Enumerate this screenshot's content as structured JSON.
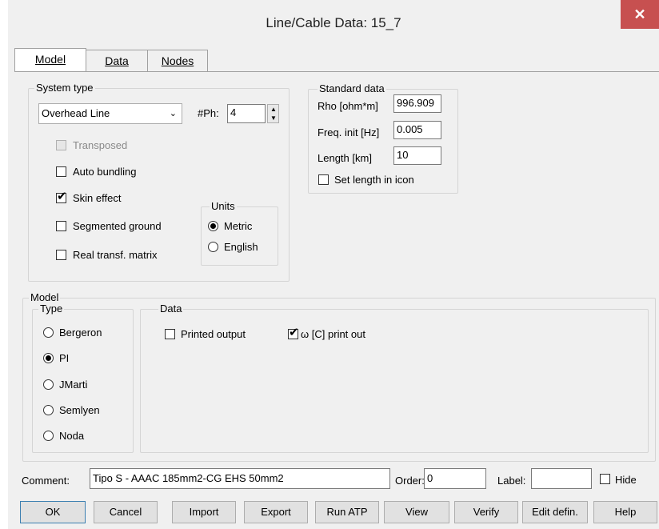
{
  "window": {
    "title": "Line/Cable Data: 15_7",
    "close_glyph": "✕"
  },
  "tabs": [
    {
      "label": "Model",
      "active": true
    },
    {
      "label": "Data",
      "active": false
    },
    {
      "label": "Nodes",
      "active": false
    }
  ],
  "system_type": {
    "group_label": "System type",
    "line_type_value": "Overhead Line",
    "phases_label": "#Ph:",
    "phases_value": "4",
    "transposed_label": "Transposed",
    "auto_bundling_label": "Auto bundling",
    "skin_effect_label": "Skin effect",
    "segmented_ground_label": "Segmented ground",
    "real_transf_label": "Real transf. matrix",
    "units": {
      "group_label": "Units",
      "metric_label": "Metric",
      "english_label": "English",
      "selected": "Metric"
    }
  },
  "standard_data": {
    "group_label": "Standard data",
    "rho_label": "Rho [ohm*m]",
    "rho_value": "996.909",
    "freq_label": "Freq. init [Hz]",
    "freq_value": "0.005",
    "length_label": "Length [km]",
    "length_value": "10",
    "set_length_label": "Set length in icon"
  },
  "model": {
    "group_label": "Model",
    "type_label": "Type",
    "types": [
      "Bergeron",
      "PI",
      "JMarti",
      "Semlyen",
      "Noda"
    ],
    "selected_type": "PI",
    "data_label": "Data",
    "printed_output_label": "Printed output",
    "omega_print_label": "[C] print out",
    "omega_symbol": "ω"
  },
  "footer": {
    "comment_label": "Comment:",
    "comment_value": "Tipo S - AAAC 185mm2-CG EHS 50mm2",
    "order_label": "Order:",
    "order_value": "0",
    "label_label": "Label:",
    "label_value": "",
    "hide_label": "Hide"
  },
  "buttons": [
    "OK",
    "Cancel",
    "Import",
    "Export",
    "Run ATP",
    "View",
    "Verify",
    "Edit defin.",
    "Help"
  ]
}
